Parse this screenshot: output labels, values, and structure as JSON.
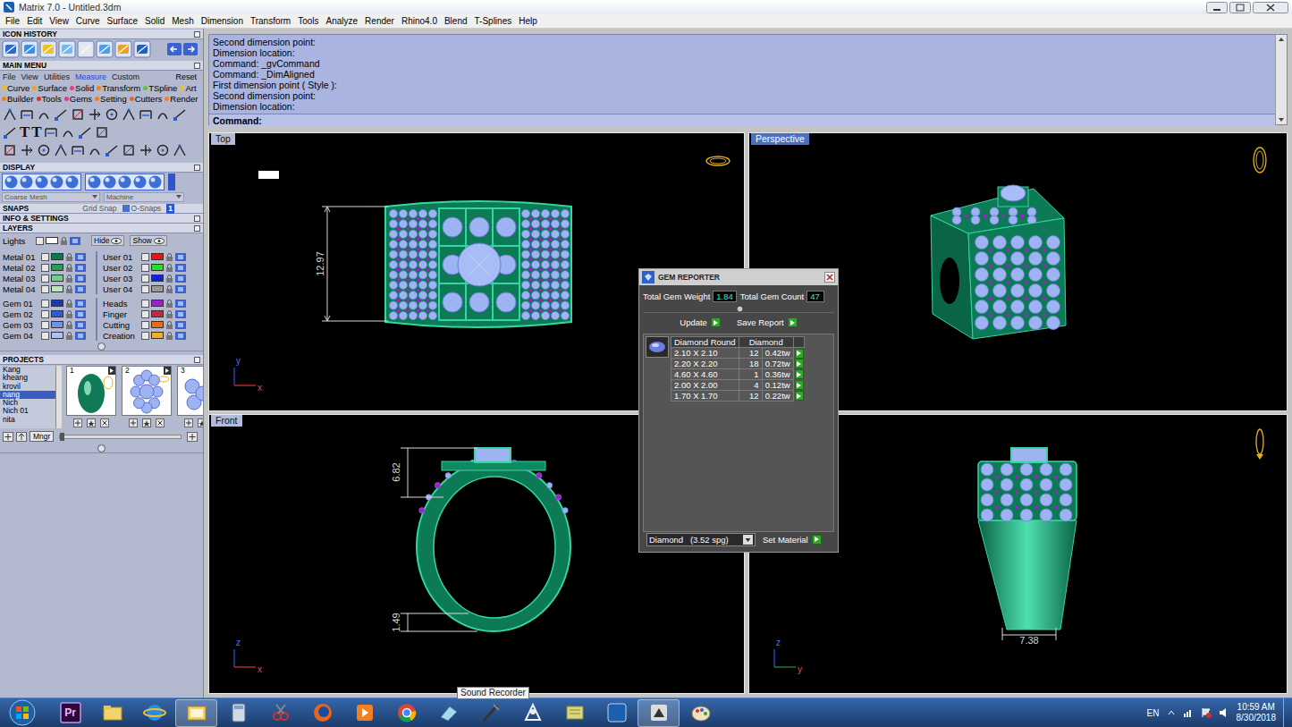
{
  "window": {
    "title": "Matrix 7.0 - Untitled.3dm"
  },
  "menu_bar": [
    "File",
    "Edit",
    "View",
    "Curve",
    "Surface",
    "Solid",
    "Mesh",
    "Dimension",
    "Transform",
    "Tools",
    "Analyze",
    "Render",
    "Rhino4.0",
    "Blend",
    "T-Splines",
    "Help"
  ],
  "left_panel": {
    "icon_history": {
      "title": "ICON HISTORY"
    },
    "main_menu": {
      "title": "MAIN MENU",
      "tabs": [
        {
          "label": "File",
          "selected": false
        },
        {
          "label": "View",
          "selected": false
        },
        {
          "label": "Utilities",
          "selected": false
        },
        {
          "label": "Measure",
          "selected": true
        },
        {
          "label": "Custom",
          "selected": false
        }
      ],
      "reset": "Reset",
      "category_rows": [
        [
          {
            "label": "Curve",
            "color": "#f0c020"
          },
          {
            "label": "Surface",
            "color": "#f0a020"
          },
          {
            "label": "Solid",
            "color": "#e04080"
          },
          {
            "label": "Transform",
            "color": "#f08020"
          },
          {
            "label": "TSpline",
            "color": "#60c040"
          },
          {
            "label": "Art",
            "color": "#f0c020"
          }
        ],
        [
          {
            "label": "Builder",
            "color": "#f08020"
          },
          {
            "label": "Tools",
            "color": "#e03030"
          },
          {
            "label": "Gems",
            "color": "#e04080"
          },
          {
            "label": "Setting",
            "color": "#f08020"
          },
          {
            "label": "Cutters",
            "color": "#f06020"
          },
          {
            "label": "Render",
            "color": "#f08020"
          }
        ]
      ],
      "text_tools": [
        "T",
        "T"
      ]
    },
    "display": {
      "title": "DISPLAY",
      "mesh": "Coarse Mesh",
      "material": "Machine"
    },
    "snaps": {
      "title": "SNAPS",
      "grid": "Grid Snap",
      "osnaps": "O-Snaps",
      "badge": "1"
    },
    "info": {
      "title": "INFO & SETTINGS"
    },
    "layers": {
      "title": "LAYERS",
      "lights": "Lights",
      "hide": "Hide",
      "show": "Show",
      "groups": [
        {
          "left": [
            {
              "name": "Metal 01",
              "color": "#0b7a50"
            },
            {
              "name": "Metal 02",
              "color": "#21a05c"
            },
            {
              "name": "Metal 03",
              "color": "#6fd18a"
            },
            {
              "name": "Metal 04",
              "color": "#b8e8c0"
            }
          ],
          "right": [
            {
              "name": "User 01",
              "color": "#e01818"
            },
            {
              "name": "User 02",
              "color": "#22e022"
            },
            {
              "name": "User 03",
              "color": "#1020e0"
            },
            {
              "name": "User 04",
              "color": "#9a9a9a"
            }
          ]
        },
        {
          "left": [
            {
              "name": "Gem 01",
              "color": "#183cb0"
            },
            {
              "name": "Gem 02",
              "color": "#2e5bd0"
            },
            {
              "name": "Gem 03",
              "color": "#6f92e8"
            },
            {
              "name": "Gem 04",
              "color": "#a9c4f4"
            }
          ],
          "right": [
            {
              "name": "Heads",
              "color": "#9a22c8"
            },
            {
              "name": "Finger",
              "color": "#c02848"
            },
            {
              "name": "Cutting",
              "color": "#f06a10"
            },
            {
              "name": "Creation",
              "color": "#f0b020"
            }
          ]
        }
      ]
    },
    "projects": {
      "title": "PROJECTS",
      "items": [
        {
          "label": "Kang",
          "selected": false
        },
        {
          "label": "kheang",
          "selected": false
        },
        {
          "label": "krovil",
          "selected": false
        },
        {
          "label": "nang",
          "selected": true
        },
        {
          "label": "Nich",
          "selected": false
        },
        {
          "label": "Nich 01",
          "selected": false
        },
        {
          "label": "nita",
          "selected": false
        }
      ],
      "thumbs": [
        "1",
        "2",
        "3"
      ],
      "mngr": "Mngr"
    }
  },
  "command": {
    "lines": [
      "Second dimension point:",
      "Dimension location:",
      "Command: _gvCommand",
      "Command: _DimAligned",
      "First dimension point ( Style ):",
      "Second dimension point:",
      "Dimension location:"
    ],
    "prompt": "Command:"
  },
  "viewports": [
    {
      "label": "Top",
      "selected": false,
      "kind": "top",
      "dimensions": [
        "12.97"
      ],
      "axes": [
        "y",
        "x"
      ]
    },
    {
      "label": "Perspective",
      "selected": true,
      "kind": "perspective",
      "dimensions": [],
      "axes": []
    },
    {
      "label": "Front",
      "selected": false,
      "kind": "front",
      "dimensions": [
        "6.82",
        "1.49"
      ],
      "axes": [
        "z",
        "x"
      ]
    },
    {
      "selected": false,
      "kind": "side",
      "dimensions": [
        "7.38"
      ],
      "axes": [
        "z",
        "y"
      ]
    }
  ],
  "gem_reporter": {
    "title": "GEM REPORTER",
    "weight_label": "Total Gem Weight",
    "weight": "1.84",
    "count_label": "Total Gem Count",
    "count": "47",
    "update": "Update",
    "save": "Save Report",
    "columns": [
      "Diamond Round",
      "Diamond"
    ],
    "rows": [
      [
        "2.10 X 2.10",
        "12",
        "0.42tw"
      ],
      [
        "2.20 X 2.20",
        "18",
        "0.72tw"
      ],
      [
        "4.60 X 4.60",
        "1",
        "0.36tw"
      ],
      [
        "2.00 X 2.00",
        "4",
        "0.12tw"
      ],
      [
        "1.70 X 1.70",
        "12",
        "0.22tw"
      ]
    ],
    "material": "Diamond   (3.52 spg)",
    "set_material": "Set Material"
  },
  "tooltip": "Sound Recorder",
  "taskbar": {
    "apps": [
      {
        "kind": "premiere",
        "label": "Pr",
        "selected": false
      },
      {
        "kind": "folder",
        "selected": false
      },
      {
        "kind": "ie",
        "selected": false
      },
      {
        "kind": "explorer",
        "selected": true
      },
      {
        "kind": "calculator",
        "selected": false
      },
      {
        "kind": "snipping",
        "selected": false
      },
      {
        "kind": "firefox",
        "selected": false
      },
      {
        "kind": "media",
        "selected": false
      },
      {
        "kind": "chrome",
        "selected": false
      },
      {
        "kind": "eraser",
        "selected": false
      },
      {
        "kind": "pen",
        "selected": false
      },
      {
        "kind": "zbrush",
        "selected": false
      },
      {
        "kind": "notes",
        "selected": false
      },
      {
        "kind": "matrix",
        "selected": false
      },
      {
        "kind": "app",
        "selected": true
      },
      {
        "kind": "paint",
        "selected": false
      }
    ],
    "lang": "EN",
    "time": "10:59 AM",
    "date": "8/30/2018"
  }
}
